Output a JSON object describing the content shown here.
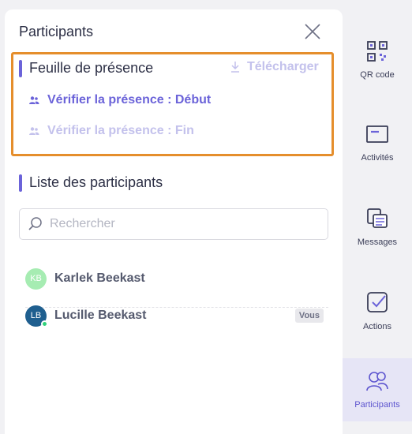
{
  "panel": {
    "title": "Participants"
  },
  "attendance": {
    "title": "Feuille de présence",
    "download_label": "Télécharger",
    "check_start_label": "Vérifier la présence : Début",
    "check_end_label": "Vérifier la présence : Fin"
  },
  "participants_list": {
    "title": "Liste des participants",
    "search_placeholder": "Rechercher",
    "search_value": "",
    "items": [
      {
        "initials": "KB",
        "name": "Karlek Beekast",
        "avatar_color": "#a6ecb2",
        "online": false,
        "badge": ""
      },
      {
        "initials": "LB",
        "name": "Lucille Beekast",
        "avatar_color": "#1f5f8f",
        "online": true,
        "badge": "Vous"
      }
    ]
  },
  "sidebar": {
    "items": [
      {
        "label": "QR code",
        "icon": "qr-code-icon",
        "active": false
      },
      {
        "label": "Activités",
        "icon": "activities-icon",
        "active": false
      },
      {
        "label": "Messages",
        "icon": "messages-icon",
        "active": false
      },
      {
        "label": "Actions",
        "icon": "actions-checkbox-icon",
        "active": false
      },
      {
        "label": "Participants",
        "icon": "participants-icon",
        "active": true
      }
    ]
  },
  "colors": {
    "accent": "#6b63d9",
    "accent_light": "#c3c1ec",
    "highlight": "#e58e2c",
    "text": "#2c2f45"
  }
}
